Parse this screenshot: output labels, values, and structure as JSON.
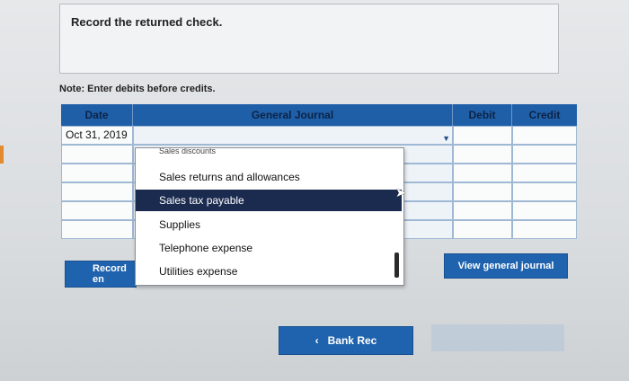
{
  "task": {
    "instruction": "Record the returned check."
  },
  "note": "Note: Enter debits before credits.",
  "table": {
    "headers": {
      "date": "Date",
      "general_journal": "General Journal",
      "debit": "Debit",
      "credit": "Credit"
    },
    "rows": [
      {
        "date": "Oct 31, 2019",
        "general_journal": "",
        "debit": "",
        "credit": ""
      },
      {
        "date": "",
        "general_journal": "",
        "debit": "",
        "credit": ""
      },
      {
        "date": "",
        "general_journal": "",
        "debit": "",
        "credit": ""
      },
      {
        "date": "",
        "general_journal": "",
        "debit": "",
        "credit": ""
      },
      {
        "date": "",
        "general_journal": "",
        "debit": "",
        "credit": ""
      },
      {
        "date": "",
        "general_journal": "",
        "debit": "",
        "credit": ""
      }
    ]
  },
  "dropdown": {
    "partial_item": "Sales discounts",
    "items": [
      "Sales returns and allowances",
      "Sales tax payable",
      "Supplies",
      "Telephone expense",
      "Utilities expense"
    ],
    "selected": "Sales tax payable"
  },
  "buttons": {
    "record_entry": "Record en",
    "view_general_journal": "View general journal",
    "bank_rec": "Bank Rec"
  },
  "icons": {
    "dropdown": "chevron-down-icon",
    "back": "chevron-left-icon",
    "cursor": "mouse-pointer-icon"
  },
  "colors": {
    "header_blue": "#1f5fa8",
    "selected_row": "#1b2b4f",
    "button_blue": "#1f63ae"
  }
}
